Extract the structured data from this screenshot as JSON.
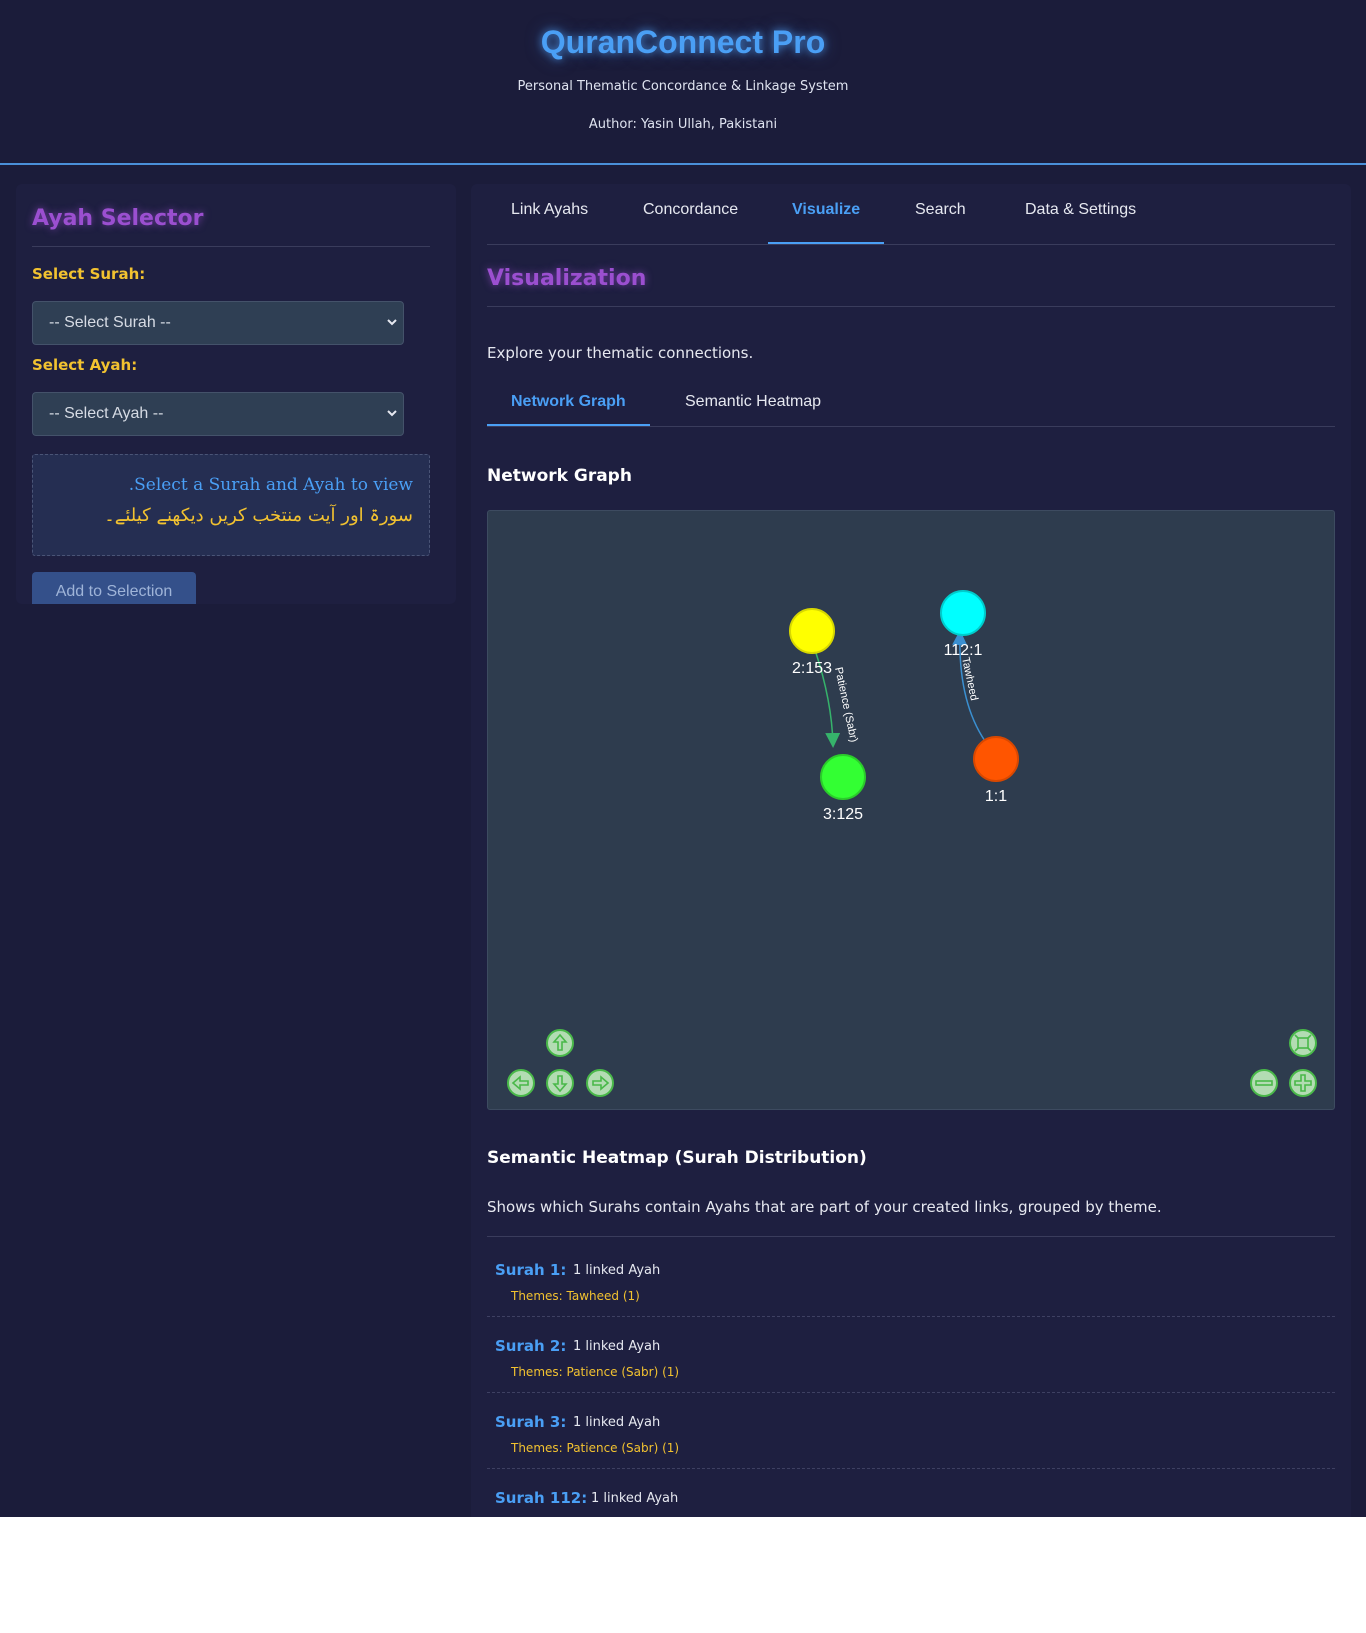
{
  "header": {
    "title": "QuranConnect Pro",
    "subtitle": "Personal Thematic Concordance & Linkage System",
    "author": "Author: Yasin Ullah, Pakistani"
  },
  "selector": {
    "title": "Ayah Selector",
    "surah_label": "Select Surah:",
    "surah_value": "-- Select Surah --",
    "ayah_label": "Select Ayah:",
    "ayah_value": "-- Select Ayah --",
    "display_en": ".Select a Surah and Ayah to view",
    "display_ur": "سورۃ اور آیت منتخب کریں دیکھنے کیلئے۔",
    "add_button": "Add to Selection"
  },
  "tabs": [
    {
      "label": "Link Ayahs"
    },
    {
      "label": "Concordance"
    },
    {
      "label": "Visualize"
    },
    {
      "label": "Search"
    },
    {
      "label": "Data & Settings"
    }
  ],
  "visualization": {
    "title": "Visualization",
    "intro": "Explore your thematic connections.",
    "subtabs": [
      {
        "label": "Network Graph"
      },
      {
        "label": "Semantic Heatmap"
      }
    ],
    "graph_title": "Network Graph",
    "nodes": [
      {
        "label": "2:153",
        "color": "#ffff00"
      },
      {
        "label": "3:125",
        "color": "#33ff33"
      },
      {
        "label": "112:1",
        "color": "#00ffff"
      },
      {
        "label": "1:1",
        "color": "#ff5500"
      }
    ],
    "edges": [
      {
        "label": "Patience (Sabr)"
      },
      {
        "label": "Tawheed"
      }
    ]
  },
  "heatmap": {
    "title": "Semantic Heatmap (Surah Distribution)",
    "description": "Shows which Surahs contain Ayahs that are part of your created links, grouped by theme.",
    "rows": [
      {
        "surah": "Surah 1:",
        "count": "1 linked Ayah",
        "themes": "Themes: Tawheed (1)"
      },
      {
        "surah": "Surah 2:",
        "count": "1 linked Ayah",
        "themes": "Themes: Patience (Sabr) (1)"
      },
      {
        "surah": "Surah 3:",
        "count": "1 linked Ayah",
        "themes": "Themes: Patience (Sabr) (1)"
      },
      {
        "surah": "Surah 112:",
        "count": "1 linked Ayah",
        "themes": ""
      }
    ]
  },
  "colors": {
    "accent_blue": "#4a9ff5",
    "accent_purple": "#9b4fd0",
    "accent_gold": "#f2c230",
    "background": "#1b1c3a"
  }
}
